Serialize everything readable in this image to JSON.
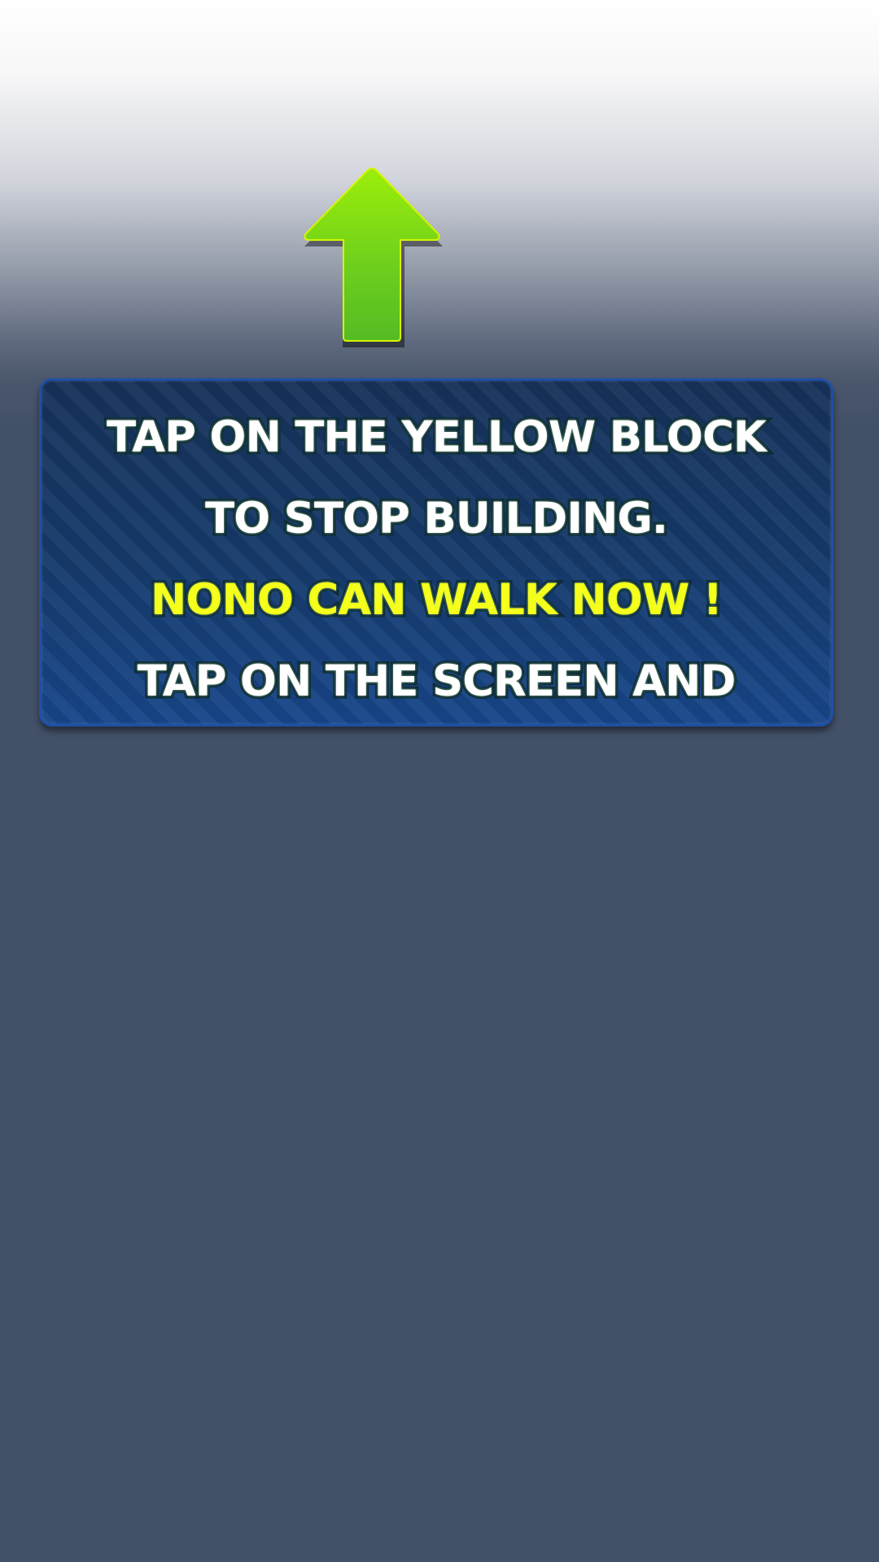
{
  "tutorial": {
    "pointer_icon": "up-arrow-icon",
    "lines": [
      "TAP ON THE YELLOW BLOCK",
      "TO STOP BUILDING.",
      "NONO CAN WALK NOW !",
      "TAP ON THE SCREEN AND"
    ],
    "highlight_line_index": 2
  },
  "colors": {
    "arrow_green": "#7fd91e",
    "panel_blue": "#163a6a",
    "panel_border": "#1f4fa8",
    "text_white": "#ffffff",
    "text_yellow": "#f4ff1c",
    "background_slate": "#435168"
  }
}
